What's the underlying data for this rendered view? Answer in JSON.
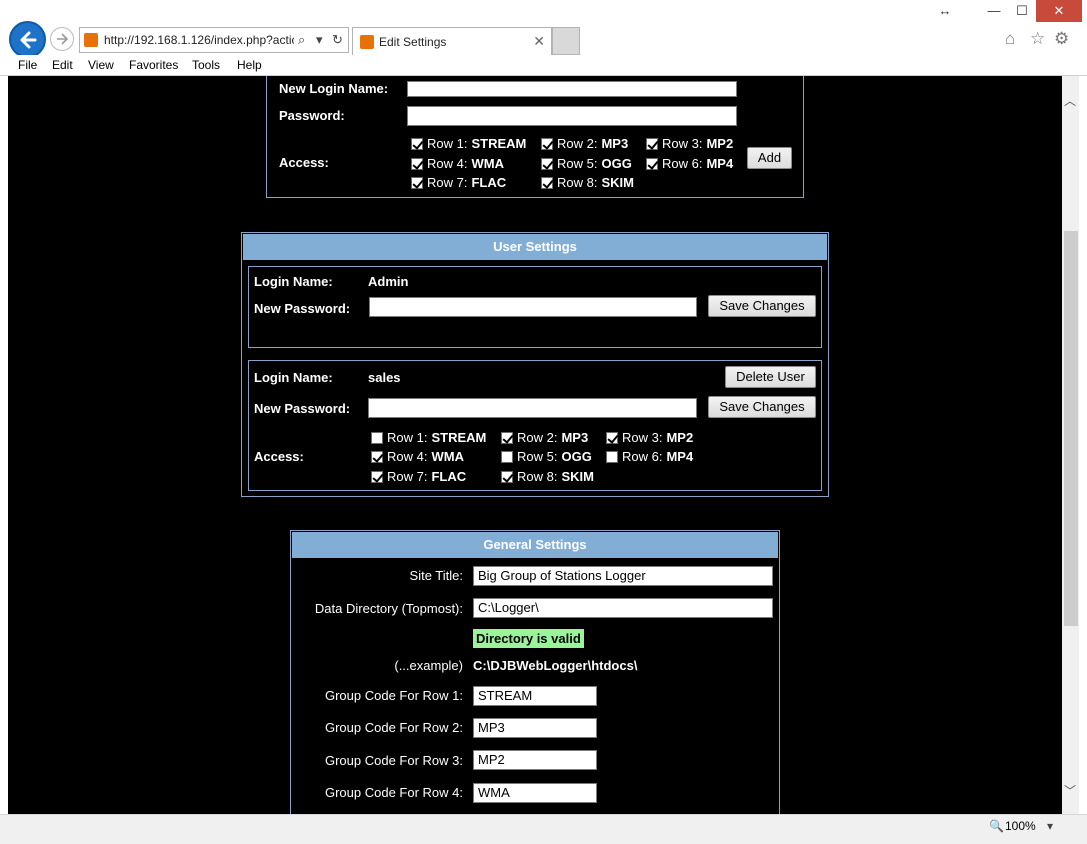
{
  "window": {
    "resize_glyph": "↔",
    "min_glyph": "—",
    "max_glyph": "☐",
    "close_glyph": "✕"
  },
  "address_bar": {
    "url": "http://192.168.1.126/index.php?actio",
    "search_glyph": "⌕",
    "dropdown_glyph": "▾",
    "refresh_glyph": "↻"
  },
  "tab": {
    "title": "Edit Settings",
    "close_glyph": "✕"
  },
  "toolbar_icons": {
    "home": "⌂",
    "favorites": "☆",
    "settings": "⚙"
  },
  "menu": {
    "file": "File",
    "edit": "Edit",
    "view": "View",
    "favorites": "Favorites",
    "tools": "Tools",
    "help": "Help"
  },
  "add_user": {
    "login_label": "New Login Name:",
    "login_value": "",
    "password_label": "Password:",
    "password_value": "",
    "access_label": "Access:",
    "add_button": "Add",
    "rows": [
      {
        "prefix": "Row 1:",
        "code": "STREAM",
        "checked": true
      },
      {
        "prefix": "Row 2:",
        "code": "MP3",
        "checked": true
      },
      {
        "prefix": "Row 3:",
        "code": "MP2",
        "checked": true
      },
      {
        "prefix": "Row 4:",
        "code": "WMA",
        "checked": true
      },
      {
        "prefix": "Row 5:",
        "code": "OGG",
        "checked": true
      },
      {
        "prefix": "Row 6:",
        "code": "MP4",
        "checked": true
      },
      {
        "prefix": "Row 7:",
        "code": "FLAC",
        "checked": true
      },
      {
        "prefix": "Row 8:",
        "code": "SKIM",
        "checked": true
      }
    ]
  },
  "user_settings": {
    "title": "User Settings",
    "admin": {
      "login_label": "Login Name:",
      "login_value": "Admin",
      "password_label": "New Password:",
      "password_value": "",
      "save_button": "Save Changes"
    },
    "sales": {
      "login_label": "Login Name:",
      "login_value": "sales",
      "delete_button": "Delete User",
      "password_label": "New Password:",
      "password_value": "",
      "save_button": "Save Changes",
      "access_label": "Access:",
      "rows": [
        {
          "prefix": "Row 1:",
          "code": "STREAM",
          "checked": false
        },
        {
          "prefix": "Row 2:",
          "code": "MP3",
          "checked": true
        },
        {
          "prefix": "Row 3:",
          "code": "MP2",
          "checked": true
        },
        {
          "prefix": "Row 4:",
          "code": "WMA",
          "checked": true
        },
        {
          "prefix": "Row 5:",
          "code": "OGG",
          "checked": false
        },
        {
          "prefix": "Row 6:",
          "code": "MP4",
          "checked": false
        },
        {
          "prefix": "Row 7:",
          "code": "FLAC",
          "checked": true
        },
        {
          "prefix": "Row 8:",
          "code": "SKIM",
          "checked": true
        }
      ]
    }
  },
  "general_settings": {
    "title": "General Settings",
    "site_title_label": "Site Title:",
    "site_title_value": "Big Group of Stations Logger",
    "data_dir_label": "Data Directory (Topmost):",
    "data_dir_value": "C:\\Logger\\",
    "dir_status": "Directory is valid",
    "dir_status_color": "#9af59a",
    "example_label": "(...example)",
    "example_value": "C:\\DJBWebLogger\\htdocs\\",
    "group_codes": [
      {
        "label": "Group Code For Row 1:",
        "value": "STREAM"
      },
      {
        "label": "Group Code For Row 2:",
        "value": "MP3"
      },
      {
        "label": "Group Code For Row 3:",
        "value": "MP2"
      },
      {
        "label": "Group Code For Row 4:",
        "value": "WMA"
      }
    ]
  },
  "status_bar": {
    "zoom": "100%",
    "zoom_glyph": "🔍",
    "dropdown_glyph": "▾"
  },
  "scrollbar": {
    "up_glyph": "︿",
    "down_glyph": "﹀"
  },
  "colors": {
    "header_bg": "#82aed6",
    "border": "#8aa2c8",
    "page_bg": "#000000"
  }
}
